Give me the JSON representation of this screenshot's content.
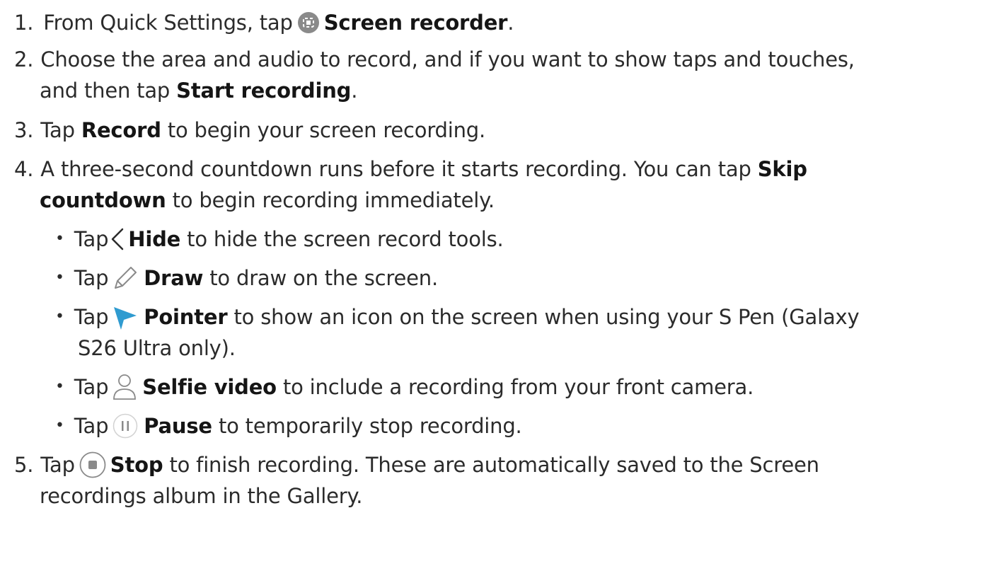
{
  "steps": [
    {
      "num": "1.",
      "pre": "From Quick Settings, tap",
      "bold": "Screen recorder",
      "post": ".",
      "icon": "screen-recorder-icon"
    },
    {
      "num": "2.",
      "line1": "Choose the area and audio to record, and if you want to show taps and touches,",
      "pre2": "and then tap",
      "bold": "Start recording",
      "post": "."
    },
    {
      "num": "3.",
      "pre": "Tap",
      "bold": "Record",
      "post": "to begin your screen recording."
    },
    {
      "num": "4.",
      "line1_pre": "A three-second countdown runs before it starts recording. You can tap",
      "bold1": "Skip",
      "bold2": "countdown",
      "post": "to begin recording immediately."
    },
    {
      "num": "5.",
      "pre": "Tap",
      "bold": "Stop",
      "post": "to finish recording. These are automatically saved to the Screen",
      "line2": "recordings album in the Gallery.",
      "icon": "stop-icon"
    }
  ],
  "sub_items": [
    {
      "pre": "Tap",
      "bold": "Hide",
      "post": "to hide the screen record tools.",
      "icon": "chevron-left-icon"
    },
    {
      "pre": "Tap",
      "bold": "Draw",
      "post": "to draw on the screen.",
      "icon": "pencil-icon"
    },
    {
      "pre": "Tap",
      "bold": "Pointer",
      "post": "to show an icon on the screen when using your S Pen (Galaxy",
      "line2": "S26 Ultra only).",
      "icon": "pointer-icon"
    },
    {
      "pre": "Tap",
      "bold": "Selfie video",
      "post": "to include a recording from your front camera.",
      "icon": "person-icon"
    },
    {
      "pre": "Tap",
      "bold": "Pause",
      "post": "to temporarily stop recording.",
      "icon": "pause-icon"
    }
  ],
  "bullet_glyph": "•",
  "colors": {
    "text": "#2b2b2b",
    "bold": "#151515",
    "icon_gray": "#8a8a8a",
    "pointer_blue": "#2f9bd0"
  }
}
